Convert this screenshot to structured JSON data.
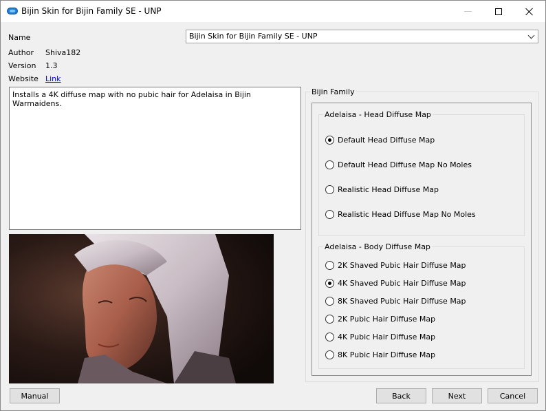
{
  "window": {
    "title": "Bijin Skin for Bijin Family SE - UNP"
  },
  "info": {
    "name_label": "Name",
    "name_value": "Bijin Skin for Bijin Family SE - UNP",
    "author_label": "Author",
    "author_value": "Shiva182",
    "version_label": "Version",
    "version_value": "1.3",
    "website_label": "Website",
    "website_value": "Link"
  },
  "description": "Installs a 4K diffuse map with no pubic hair for Adelaisa in Bijin Warmaidens.",
  "options": {
    "group_title": "Bijin Family",
    "head": {
      "title": "Adelaisa - Head Diffuse Map",
      "items": [
        {
          "label": "Default Head Diffuse Map",
          "checked": true
        },
        {
          "label": "Default Head Diffuse Map No Moles",
          "checked": false
        },
        {
          "label": "Realistic Head Diffuse Map",
          "checked": false
        },
        {
          "label": "Realistic Head Diffuse Map No Moles",
          "checked": false
        }
      ]
    },
    "body": {
      "title": "Adelaisa - Body Diffuse Map",
      "items": [
        {
          "label": "2K Shaved Pubic Hair Diffuse Map",
          "checked": false
        },
        {
          "label": "4K Shaved Pubic Hair Diffuse Map",
          "checked": true
        },
        {
          "label": "8K Shaved Pubic Hair Diffuse Map",
          "checked": false
        },
        {
          "label": "2K Pubic Hair Diffuse Map",
          "checked": false
        },
        {
          "label": "4K Pubic Hair Diffuse Map",
          "checked": false
        },
        {
          "label": "8K Pubic Hair Diffuse Map",
          "checked": false
        }
      ]
    }
  },
  "buttons": {
    "manual": "Manual",
    "back": "Back",
    "next": "Next",
    "cancel": "Cancel"
  }
}
